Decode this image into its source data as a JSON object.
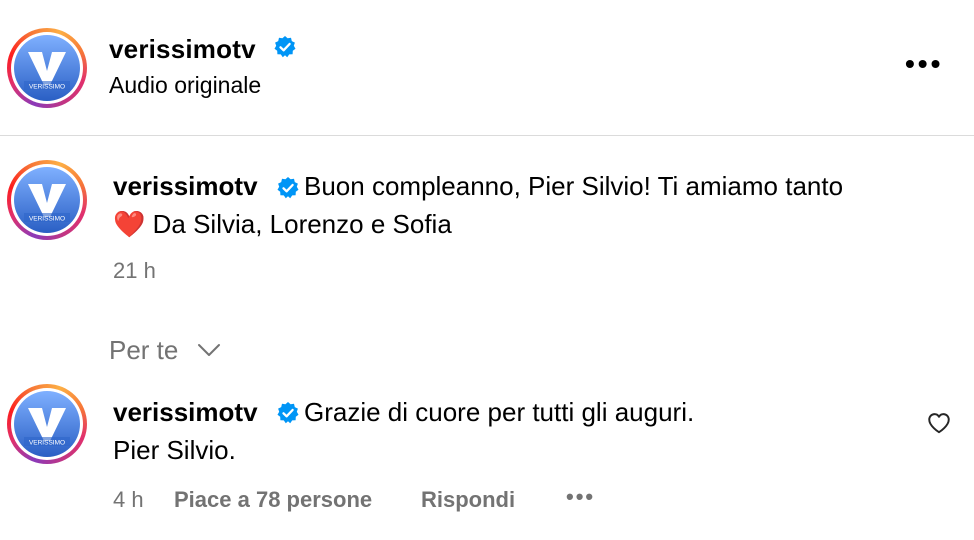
{
  "header": {
    "username": "verissimotv",
    "subtitle": "Audio originale",
    "more_label": "•••"
  },
  "caption": {
    "username": "verissimotv",
    "line1": "Buon compleanno, Pier Silvio! Ti amiamo tanto",
    "heart_emoji": "❤️",
    "line2": "Da Silvia, Lorenzo e Sofia",
    "time": "21 h"
  },
  "filter": {
    "label": "Per te"
  },
  "comment": {
    "username": "verissimotv",
    "line1": "Grazie di cuore per tutti gli auguri.",
    "line2": "Pier Silvio.",
    "time": "4 h",
    "likes": "Piace a 78 persone",
    "reply": "Rispondi",
    "more_label": "•••"
  },
  "avatar": {
    "logo_text": "VERISSIMO"
  },
  "colors": {
    "verified": "#0095f6",
    "meta": "#737373",
    "divider": "#dbdbdb",
    "logo_blue": "#3b78d8"
  }
}
